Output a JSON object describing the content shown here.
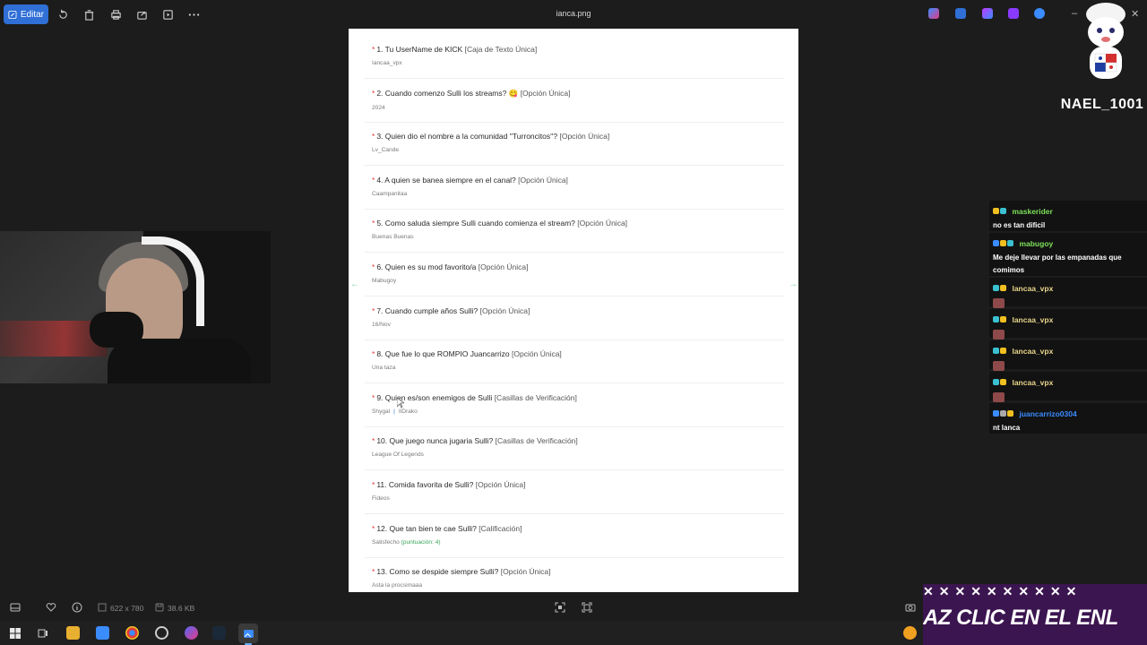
{
  "toolbar": {
    "edit_label": "Editar",
    "file_title": "ianca.png"
  },
  "questions": [
    {
      "title": "1. Tu UserName de KICK",
      "type": "[Caja de Texto Única]",
      "answer": "Iancaa_vpx"
    },
    {
      "title": "2. Cuando comenzo Sulli los streams? 😋",
      "type": "[Opción Única]",
      "answer": "2024"
    },
    {
      "title": "3. Quien dio el nombre a la comunidad ''Turroncitos''?",
      "type": "[Opción Única]",
      "answer": "Lv_Cande"
    },
    {
      "title": "4. A quien se banea siempre en el canal?",
      "type": "[Opción Única]",
      "answer": "Caampanitaa"
    },
    {
      "title": "5. Como saluda siempre Sulli cuando comienza el stream?",
      "type": "[Opción Única]",
      "answer": "Buenas Buenas"
    },
    {
      "title": "6. Quien es su mod favorito/a",
      "type": "[Opción Única]",
      "answer": "Mabugoy"
    },
    {
      "title": "7. Cuando cumple años Sulli?",
      "type": "[Opción Única]",
      "answer": "16/Nov"
    },
    {
      "title": "8. Que fue lo que ROMPIO Juancarrizo",
      "type": "[Opción Única]",
      "answer": "Una taza"
    },
    {
      "title": "9. Quien es/son enemigos de Sulli",
      "type": "[Casillas de Verificación]",
      "answer": "Shygal",
      "answer2": "IlDrako"
    },
    {
      "title": "10. Que juego nunca jugaria Sulli?",
      "type": "[Casillas de Verificación]",
      "answer": "League Of Legends"
    },
    {
      "title": "11. Comida favorita de Sulli?",
      "type": "[Opción Única]",
      "answer": "Fideos"
    },
    {
      "title": "12. Que tan bien te cae Sulli?",
      "type": "[Calificación]",
      "answer": "Satisfecho",
      "score": "(puntuación: 4)"
    },
    {
      "title": "13. Como se despide siempre Sulli?",
      "type": "[Opción Única]",
      "answer": "Asta la procsimaaa"
    }
  ],
  "overlay": {
    "streamer_name": "NAEL_1001"
  },
  "chat": [
    {
      "user": "maskerider",
      "color": "#7ee05a",
      "text": "no es tan dificil"
    },
    {
      "user": "mabugoy",
      "color": "#7ee05a",
      "text": "Me deje llevar por las empanadas que comimos"
    },
    {
      "user": "lancaa_vpx",
      "color": "#e8d48a",
      "text": ""
    },
    {
      "user": "lancaa_vpx",
      "color": "#e8d48a",
      "text": ""
    },
    {
      "user": "lancaa_vpx",
      "color": "#e8d48a",
      "text": ""
    },
    {
      "user": "lancaa_vpx",
      "color": "#e8d48a",
      "text": ""
    },
    {
      "user": "juancarrizo0304",
      "color": "#3a8cff",
      "text": "nt lanca"
    }
  ],
  "statusbar": {
    "dimensions": "622 x 780",
    "filesize": "38.6 KB"
  },
  "banner": {
    "marks": "✕✕✕✕✕✕✕✕✕✕",
    "text": "AZ CLIC EN EL ENL"
  },
  "colors": {
    "accent": "#2f6fd6",
    "required": "#e23b3b",
    "score": "#3aa55a"
  }
}
